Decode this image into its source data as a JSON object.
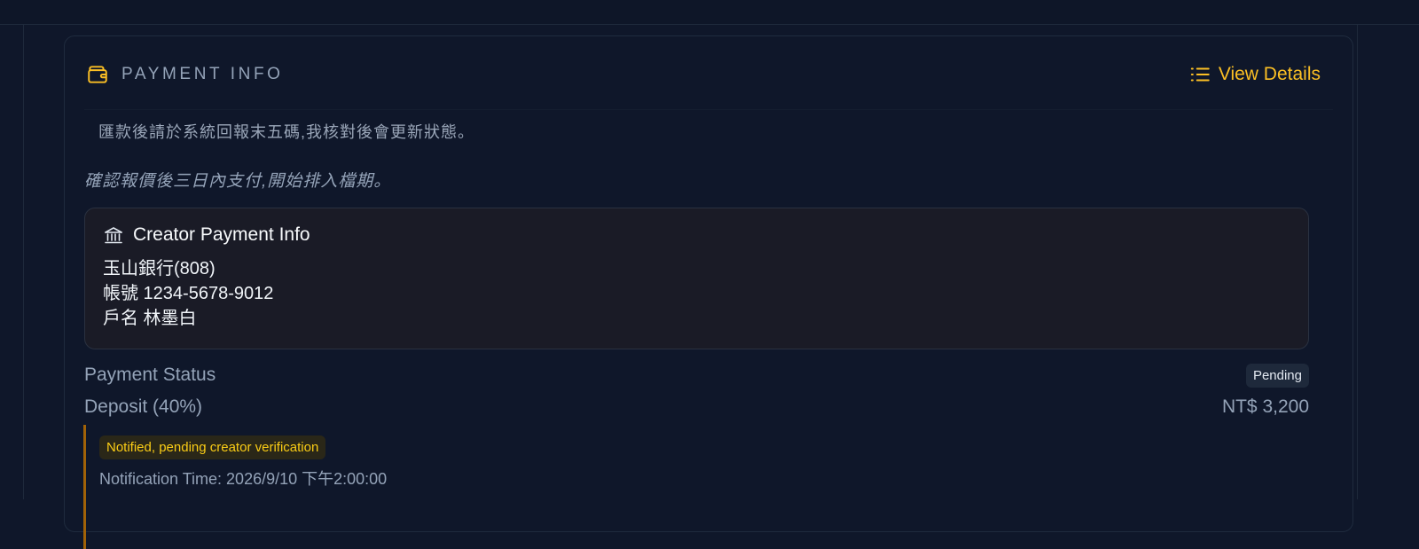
{
  "card": {
    "title": "PAYMENT INFO",
    "view_details_label": "View Details",
    "instruction": "匯款後請於系統回報末五碼,我核對後會更新狀態。",
    "note": "確認報價後三日內支付,開始排入檔期。"
  },
  "creator_payment": {
    "title": "Creator Payment Info",
    "lines": [
      "玉山銀行(808)",
      "帳號 1234-5678-9012",
      "戶名 林墨白"
    ]
  },
  "status": {
    "label": "Payment Status",
    "badge": "Pending"
  },
  "deposit": {
    "label": "Deposit (40%)",
    "amount": "NT$ 3,200"
  },
  "notification": {
    "badge": "Notified, pending creator verification",
    "time": "Notification Time: 2026/9/10 下午2:00:00"
  },
  "icons": {
    "title_icon": "wallet-icon",
    "details_icon": "list-icon",
    "bank_icon": "bank-icon"
  },
  "colors": {
    "accent": "#fbbf24",
    "background": "#0f172a",
    "timeline_border": "#a16207"
  }
}
